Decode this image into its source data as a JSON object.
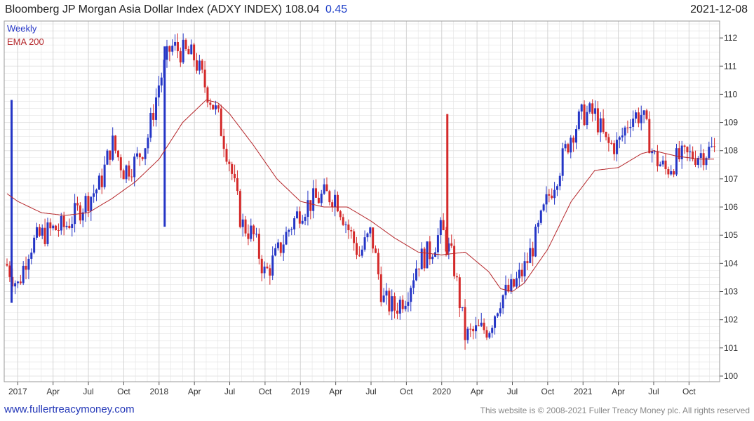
{
  "header": {
    "title": "Bloomberg JP Morgan Asia Dollar Index (ADXY INDEX) 108.04",
    "change": "0.45",
    "date": "2021-12-08"
  },
  "footer": {
    "website": "www.fullertreacymoney.com",
    "copyright": "This website is © 2008-2021 Fuller Treacy Money plc. All rights reserved"
  },
  "colors": {
    "up_candle": "#2536c6",
    "down_candle": "#d42a2a",
    "ema_line": "#b5262a",
    "grid": "#e4e4e4",
    "axis": "#9a9a9a"
  },
  "chart_data": {
    "type": "line",
    "title": "Bloomberg JP Morgan Asia Dollar Index (ADXY INDEX) 108.04 0.45",
    "frequency": "Weekly",
    "ylim": [
      99.8,
      112.6
    ],
    "y_ticks": [
      100,
      101,
      102,
      103,
      104,
      105,
      106,
      107,
      108,
      109,
      110,
      111,
      112
    ],
    "x_ticks": [
      "2017",
      "Apr",
      "Jul",
      "Oct",
      "2018",
      "Apr",
      "Jul",
      "Oct",
      "2019",
      "Apr",
      "Jul",
      "Oct",
      "2020",
      "Apr",
      "Jul",
      "Oct",
      "2021",
      "Apr",
      "Jul",
      "Oct"
    ],
    "x_tick_dates": [
      "2017-01",
      "2017-04",
      "2017-07",
      "2017-10",
      "2018-01",
      "2018-04",
      "2018-07",
      "2018-10",
      "2019-01",
      "2019-04",
      "2019-07",
      "2019-10",
      "2020-01",
      "2020-04",
      "2020-07",
      "2020-10",
      "2021-01",
      "2021-04",
      "2021-07",
      "2021-10"
    ],
    "legend": [
      "Weekly",
      "EMA 200"
    ],
    "legend_position": "top-left",
    "grid": true,
    "series": [
      {
        "name": "Weekly",
        "points": [
          [
            "2016-12",
            104.0
          ],
          [
            "2017-01",
            103.2
          ],
          [
            "2017-02",
            104.6
          ],
          [
            "2017-03",
            105.0
          ],
          [
            "2017-04",
            105.2
          ],
          [
            "2017-05",
            105.3
          ],
          [
            "2017-06",
            105.8
          ],
          [
            "2017-07",
            106.3
          ],
          [
            "2017-08",
            106.8
          ],
          [
            "2017-09",
            108.3
          ],
          [
            "2017-10",
            107.3
          ],
          [
            "2017-11",
            107.6
          ],
          [
            "2017-12",
            108.4
          ],
          [
            "2018-01",
            110.4
          ],
          [
            "2018-02",
            111.7
          ],
          [
            "2018-03",
            111.5
          ],
          [
            "2018-04",
            111.3
          ],
          [
            "2018-05",
            110.2
          ],
          [
            "2018-06",
            109.2
          ],
          [
            "2018-07",
            107.6
          ],
          [
            "2018-08",
            105.4
          ],
          [
            "2018-09",
            105.0
          ],
          [
            "2018-10",
            103.6
          ],
          [
            "2018-11",
            104.3
          ],
          [
            "2018-12",
            105.2
          ],
          [
            "2019-01",
            105.9
          ],
          [
            "2019-02",
            106.2
          ],
          [
            "2019-03",
            106.4
          ],
          [
            "2019-04",
            106.4
          ],
          [
            "2019-05",
            105.3
          ],
          [
            "2019-06",
            104.3
          ],
          [
            "2019-07",
            105.1
          ],
          [
            "2019-08",
            102.7
          ],
          [
            "2019-09",
            102.4
          ],
          [
            "2019-10",
            102.9
          ],
          [
            "2019-11",
            104.1
          ],
          [
            "2019-12",
            104.4
          ],
          [
            "2020-01",
            105.2
          ],
          [
            "2020-02",
            104.0
          ],
          [
            "2020-03",
            101.4
          ],
          [
            "2020-04",
            101.6
          ],
          [
            "2020-05",
            101.7
          ],
          [
            "2020-06",
            102.8
          ],
          [
            "2020-07",
            103.1
          ],
          [
            "2020-08",
            103.8
          ],
          [
            "2020-09",
            104.9
          ],
          [
            "2020-10",
            106.3
          ],
          [
            "2020-11",
            107.4
          ],
          [
            "2020-12",
            108.6
          ],
          [
            "2021-01",
            109.3
          ],
          [
            "2021-02",
            109.3
          ],
          [
            "2021-03",
            108.2
          ],
          [
            "2021-04",
            108.2
          ],
          [
            "2021-05",
            109.2
          ],
          [
            "2021-06",
            109.3
          ],
          [
            "2021-07",
            107.8
          ],
          [
            "2021-08",
            107.3
          ],
          [
            "2021-09",
            107.7
          ],
          [
            "2021-10",
            107.8
          ],
          [
            "2021-11",
            107.9
          ],
          [
            "2021-12",
            108.04
          ]
        ]
      },
      {
        "name": "EMA 200",
        "points": [
          [
            "2016-12",
            106.5
          ],
          [
            "2017-01",
            106.2
          ],
          [
            "2017-03",
            105.8
          ],
          [
            "2017-05",
            105.7
          ],
          [
            "2017-07",
            105.8
          ],
          [
            "2017-09",
            106.3
          ],
          [
            "2017-11",
            106.9
          ],
          [
            "2018-01",
            107.7
          ],
          [
            "2018-03",
            109.0
          ],
          [
            "2018-05",
            109.8
          ],
          [
            "2018-06",
            109.7
          ],
          [
            "2018-07",
            109.3
          ],
          [
            "2018-09",
            108.2
          ],
          [
            "2018-11",
            107.0
          ],
          [
            "2019-01",
            106.2
          ],
          [
            "2019-03",
            106.0
          ],
          [
            "2019-05",
            106.0
          ],
          [
            "2019-07",
            105.5
          ],
          [
            "2019-09",
            104.9
          ],
          [
            "2019-11",
            104.4
          ],
          [
            "2020-01",
            104.3
          ],
          [
            "2020-03",
            104.4
          ],
          [
            "2020-05",
            103.7
          ],
          [
            "2020-06",
            103.1
          ],
          [
            "2020-07",
            103.0
          ],
          [
            "2020-08",
            103.3
          ],
          [
            "2020-10",
            104.5
          ],
          [
            "2020-12",
            106.2
          ],
          [
            "2021-02",
            107.3
          ],
          [
            "2021-04",
            107.4
          ],
          [
            "2021-06",
            107.9
          ],
          [
            "2021-07",
            108.0
          ],
          [
            "2021-09",
            107.8
          ],
          [
            "2021-11",
            107.7
          ],
          [
            "2021-12",
            107.7
          ]
        ]
      }
    ],
    "notable_spikes": [
      {
        "date": "2016-12",
        "high": 109.8,
        "low": 102.6
      },
      {
        "date": "2018-01",
        "high": 111.7,
        "low": 105.3
      },
      {
        "date": "2020-01",
        "high": 109.3,
        "low": 104.3
      }
    ]
  }
}
